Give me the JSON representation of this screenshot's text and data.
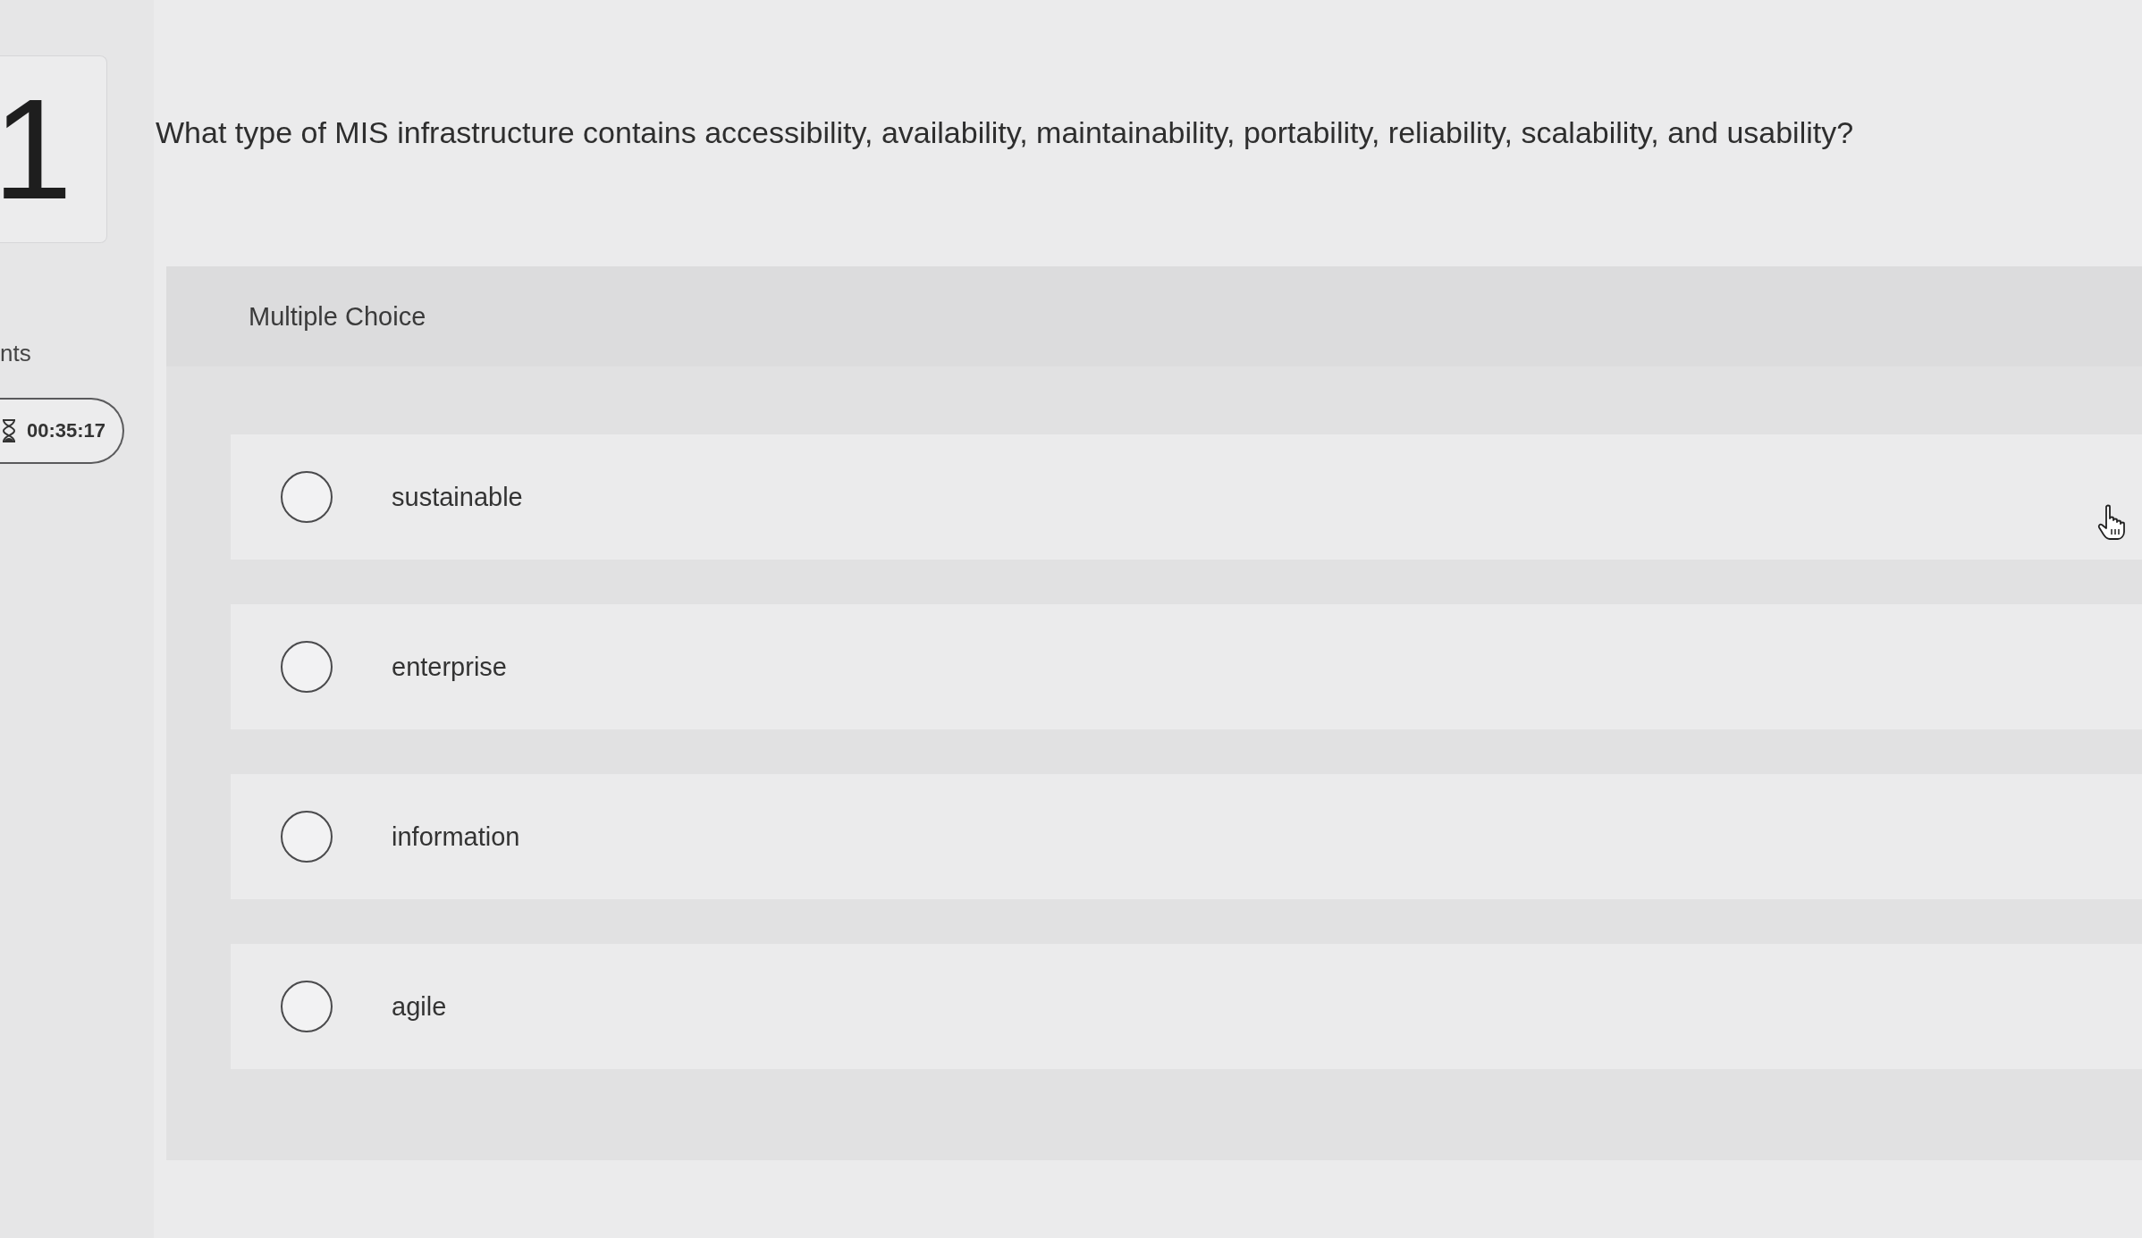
{
  "question": {
    "number": "1",
    "text": "What type of MIS infrastructure contains accessibility, availability, maintainability, portability, reliability, scalability, and usability?"
  },
  "sidebar": {
    "label": "nts",
    "timer": "00:35:17"
  },
  "answer_panel": {
    "title": "Multiple Choice",
    "options": [
      {
        "label": "sustainable",
        "selected": false
      },
      {
        "label": "enterprise",
        "selected": false
      },
      {
        "label": "information",
        "selected": false
      },
      {
        "label": "agile",
        "selected": false
      }
    ]
  }
}
